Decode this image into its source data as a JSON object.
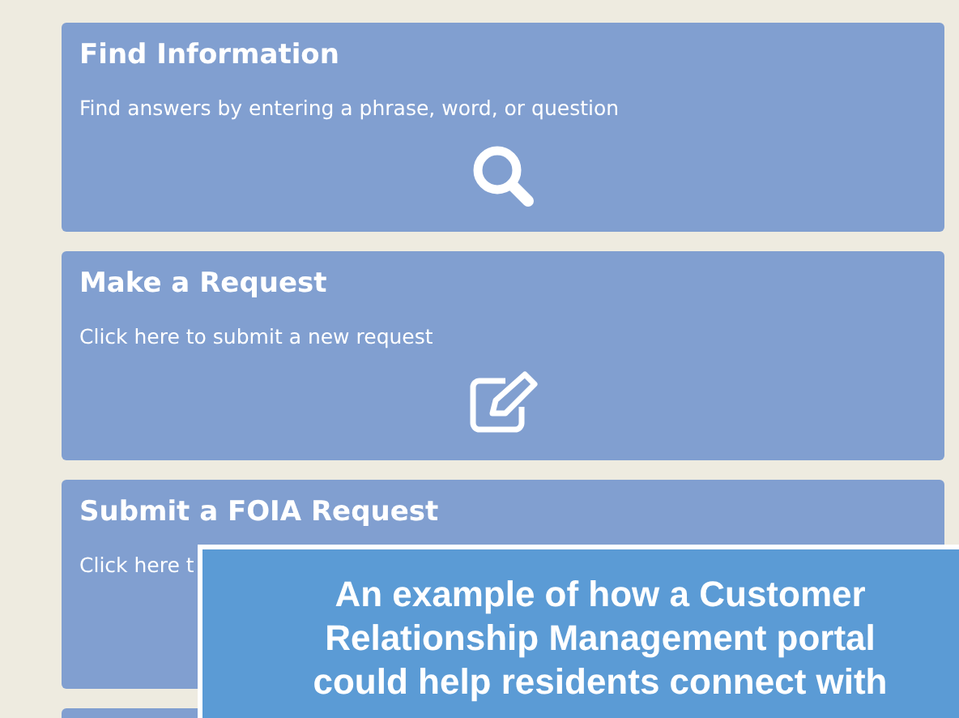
{
  "cards": [
    {
      "title": "Find Information",
      "description": "Find answers by entering a phrase, word, or question",
      "kind": "search"
    },
    {
      "title": "Make a Request",
      "description": "Click here to submit a new request",
      "kind": "edit"
    },
    {
      "title": "Submit a FOIA Request",
      "description": "Click here t",
      "kind": "plain"
    },
    {
      "kind": "blank"
    }
  ],
  "caption": {
    "lines": [
      "An example of how a Customer",
      "Relationship Management portal",
      "could help residents connect with"
    ]
  }
}
